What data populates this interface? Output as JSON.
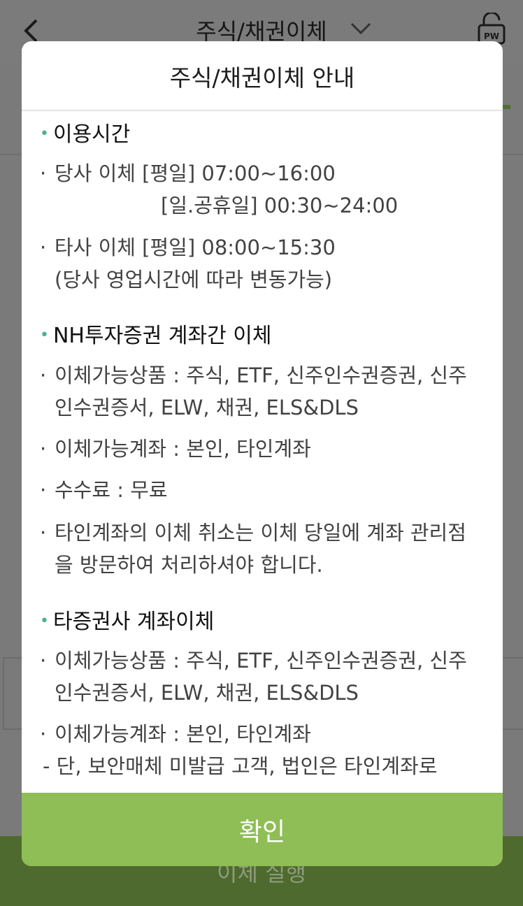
{
  "background": {
    "title": "주식/채권이체",
    "footer_label": "이체 실행",
    "lock_badge": "PW"
  },
  "modal": {
    "title": "주식/채권이체 안내",
    "sections": [
      {
        "heading": "이용시간",
        "items": [
          {
            "text": "당사 이체 [평일] 07:00~16:00",
            "extra": "[일.공휴일] 00:30~24:00"
          },
          {
            "text": "타사 이체 [평일] 08:00~15:30",
            "extra": "(당사 영업시간에 따라 변동가능)"
          }
        ]
      },
      {
        "heading": "NH투자증권 계좌간 이체",
        "items": [
          {
            "text": "이체가능상품 : 주식, ETF, 신주인수권증권, 신주인수권증서, ELW, 채권, ELS&DLS"
          },
          {
            "text": "이체가능계좌 : 본인, 타인계좌"
          },
          {
            "text": "수수료 : 무료"
          },
          {
            "text": "타인계좌의 이체 취소는 이체 당일에 계좌 관리점을 방문하여 처리하셔야 합니다."
          }
        ]
      },
      {
        "heading": "타증권사 계좌이체",
        "items": [
          {
            "text": "이체가능상품 : 주식, ETF, 신주인수권증권, 신주인수권증서, ELW, 채권, ELS&DLS"
          },
          {
            "text": "이체가능계좌 : 본인, 타인계좌",
            "note": "- 단, 보안매체 미발급 고객, 법인은 타인계좌로"
          }
        ]
      }
    ],
    "bullet": "·",
    "section_dot": "•",
    "confirm_label": "확인"
  },
  "colors": {
    "confirm_bg": "#8fbd56",
    "section_dot": "#4fae8c",
    "footer_bg": "#4e6a2e"
  }
}
